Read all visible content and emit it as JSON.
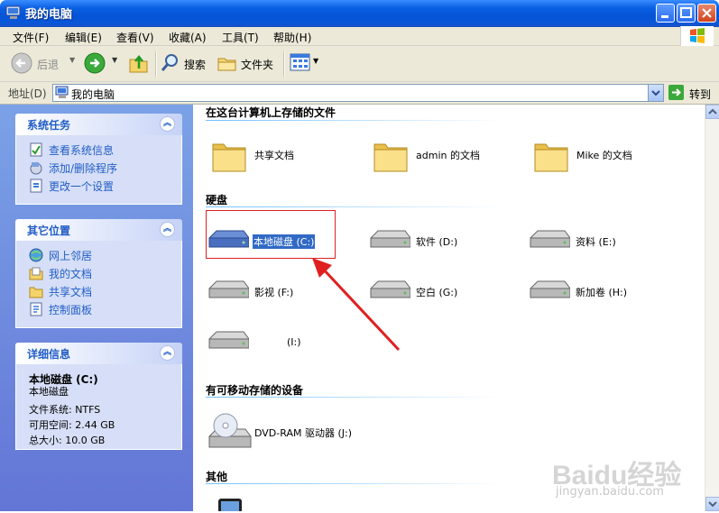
{
  "window": {
    "title": "我的电脑"
  },
  "menu": [
    "文件(F)",
    "编辑(E)",
    "查看(V)",
    "收藏(A)",
    "工具(T)",
    "帮助(H)"
  ],
  "toolbar": {
    "back": "后退",
    "search": "搜索",
    "folders": "文件夹"
  },
  "address": {
    "label": "地址(D)",
    "value": "我的电脑",
    "go": "转到"
  },
  "tasks_panel": {
    "title": "系统任务",
    "items": [
      "查看系统信息",
      "添加/删除程序",
      "更改一个设置"
    ]
  },
  "places_panel": {
    "title": "其它位置",
    "items": [
      "网上邻居",
      "我的文档",
      "共享文档",
      "控制面板"
    ]
  },
  "details_panel": {
    "title": "详细信息",
    "name": "本地磁盘 (C:)",
    "type": "本地磁盘",
    "fs": "文件系统: NTFS",
    "free": "可用空间: 2.44 GB",
    "total": "总大小: 10.0 GB"
  },
  "groups": {
    "stored_files": "在这台计算机上存储的文件",
    "hard_disks": "硬盘",
    "removable": "有可移动存储的设备",
    "other": "其他"
  },
  "folders": [
    "共享文档",
    "admin 的文档",
    "Mike 的文档"
  ],
  "drives": [
    "本地磁盘 (C:)",
    "软件 (D:)",
    "资料 (E:)",
    "影视 (F:)",
    "空白 (G:)",
    "新加卷 (H:)",
    "(I:)"
  ],
  "removable_drives": [
    "DVD-RAM 驱动器 (J:)"
  ],
  "watermark": {
    "brand": "Baidu经验",
    "url": "jingyan.baidu.com"
  },
  "colors": {
    "accent": "#215dc6",
    "highlight": "#e02020",
    "selection": "#316ac5"
  }
}
